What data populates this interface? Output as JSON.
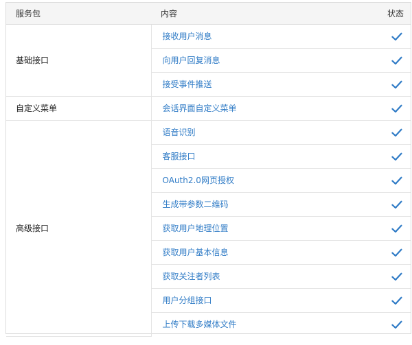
{
  "header": {
    "package": "服务包",
    "content": "内容",
    "status": "状态"
  },
  "accent_color": "#2f7bc6",
  "status_icon": "check-icon",
  "groups": [
    {
      "name": "基础接口",
      "items": [
        "接收用户消息",
        "向用户回复消息",
        "接受事件推送"
      ]
    },
    {
      "name": "自定义菜单",
      "items": [
        "会话界面自定义菜单"
      ]
    },
    {
      "name": "高级接口",
      "items": [
        "语音识别",
        "客服接口",
        "OAuth2.0网页授权",
        "生成带参数二维码",
        "获取用户地理位置",
        "获取用户基本信息",
        "获取关注者列表",
        "用户分组接口",
        "上传下载多媒体文件"
      ]
    }
  ]
}
